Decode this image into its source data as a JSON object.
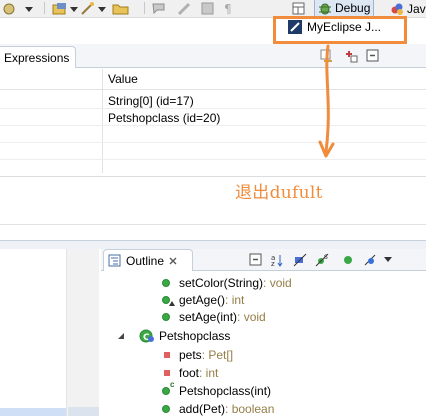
{
  "toolbar": {
    "perspectives": [
      {
        "label": "Debug",
        "active": true
      },
      {
        "label": "Java",
        "active": false
      }
    ],
    "myeclipse_label": "MyEclipse J..."
  },
  "annotation": {
    "text": "退出dufult",
    "color": "#f08c3c"
  },
  "expressions": {
    "tab_label": "Expressions",
    "column_value": "Value",
    "rows": [
      {
        "value": "String[0]  (id=17)"
      },
      {
        "value": "Petshopclass  (id=20)"
      },
      {
        "value": ""
      },
      {
        "value": ""
      },
      {
        "value": ""
      }
    ]
  },
  "outline": {
    "tab_label": "Outline",
    "items": [
      {
        "kind": "method-public",
        "name": "setColor(String)",
        "type": " : void"
      },
      {
        "kind": "method-public",
        "name": "getAge()",
        "type": " : int"
      },
      {
        "kind": "method-public",
        "name": "setAge(int)",
        "type": " : void"
      },
      {
        "kind": "class",
        "name": "Petshopclass",
        "type": ""
      },
      {
        "kind": "field-private",
        "name": "pets",
        "type": " : Pet[]"
      },
      {
        "kind": "field-private",
        "name": "foot",
        "type": " : int"
      },
      {
        "kind": "constructor",
        "name": "Petshopclass(int)",
        "type": ""
      },
      {
        "kind": "method-public",
        "name": "add(Pet)",
        "type": " : boolean"
      }
    ]
  },
  "colors": {
    "accent": "#f08c3c",
    "public_method": "#3aa845",
    "private_field": "#e06060",
    "type_text": "#957d47",
    "selection": "#cfdff5"
  }
}
